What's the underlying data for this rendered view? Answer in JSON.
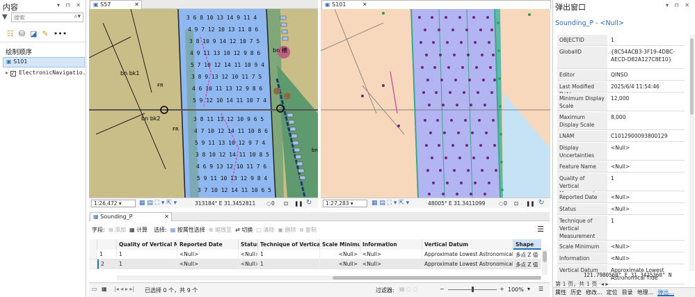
{
  "contents_panel": {
    "title": "内容",
    "search_placeholder": "搜索",
    "drawing_order": "绘制顺序",
    "layers": [
      "S101",
      "ElectronicNavigatio..."
    ]
  },
  "map_left": {
    "tab": "S57",
    "scale": "1:26,472",
    "coords": "313184° E 31.3452811",
    "zero": "0",
    "labels": [
      "bn",
      "bn bk1",
      "bn bk2",
      "FR",
      "FR",
      "bn 横"
    ]
  },
  "map_right": {
    "tab": "S101",
    "scale": "1:27,283",
    "coords": "48005° E 31.3411099",
    "zero": "0"
  },
  "attribute_table": {
    "tab": "Sounding_P",
    "toolbar": {
      "field": "字段:",
      "add": "添加",
      "calc": "计算",
      "select": "选择:",
      "by_attr": "按属性选择",
      "zoom_to": "缩放至",
      "switch": "切换",
      "clear": "清除",
      "delete": "删除",
      "copy": "复制"
    },
    "columns": [
      "Quality of Vertical M...",
      "Reported Date",
      "Status",
      "Technique of Vertical...",
      "Scale Minimum",
      "Information",
      "Vertical Datum",
      "Shape"
    ],
    "rows": [
      {
        "num": "1",
        "cells": [
          "1",
          "<Null>",
          "<Null>",
          "1",
          "<Null>",
          "<Null>",
          "Approximate Lowest Astronomical Tide",
          "多点 Z 值"
        ]
      },
      {
        "num": "2",
        "cells": [
          "1",
          "<Null>",
          "<Null>",
          "1",
          "<Null>",
          "<Null>",
          "Approximate Lowest Astronomical Tide",
          "多点 Z 值"
        ]
      }
    ],
    "status": "已选择 0 个，共 9 个",
    "filter": "过滤器:",
    "zoom": "100%"
  },
  "popup": {
    "title": "弹出窗口",
    "subtitle": "Sounding_P - <Null>",
    "fields": [
      {
        "k": "OBJECTID",
        "v": "1"
      },
      {
        "k": "GlobalID",
        "v": "{8C54ACB3-3F19-4DBC-AECD-D82A127C8E10}"
      },
      {
        "k": "Editor",
        "v": "QINSO"
      },
      {
        "k": "Last Modified Date",
        "v": "2025/6/4 11:54:46"
      },
      {
        "k": "Minimum Display Scale",
        "v": "12,000"
      },
      {
        "k": "Maximum Display Scale",
        "v": "8,000"
      },
      {
        "k": "LNAM",
        "v": "C1012900093800129"
      },
      {
        "k": "Display Uncertainties",
        "v": "<Null>"
      },
      {
        "k": "Feature Name",
        "v": "<Null>"
      },
      {
        "k": "Quality of Vertical Measurement",
        "v": "1"
      },
      {
        "k": "Reported Date",
        "v": "<Null>"
      },
      {
        "k": "Status",
        "v": "<Null>"
      },
      {
        "k": "Technique of Vertical Measurement",
        "v": "1"
      },
      {
        "k": "Scale Minimum",
        "v": "<Null>"
      },
      {
        "k": "Information",
        "v": "<Null>"
      },
      {
        "k": "Vertical Datum",
        "v": "Approximate Lowest Astronomical Tide"
      }
    ],
    "coord": "121.7980560° E 31.3425360° N",
    "pager": "第 1 页，共 1 页",
    "bottom_tabs": [
      "属性",
      "历史",
      "修改...",
      "定位",
      "目录",
      "地理...",
      "弹出..."
    ]
  },
  "colors": {
    "accent": "#2b6cb0",
    "land": "#c9bd88",
    "water": "#8fb7f0",
    "s101_land": "#f8d8bd",
    "s101_water": "#b3b5f2"
  }
}
